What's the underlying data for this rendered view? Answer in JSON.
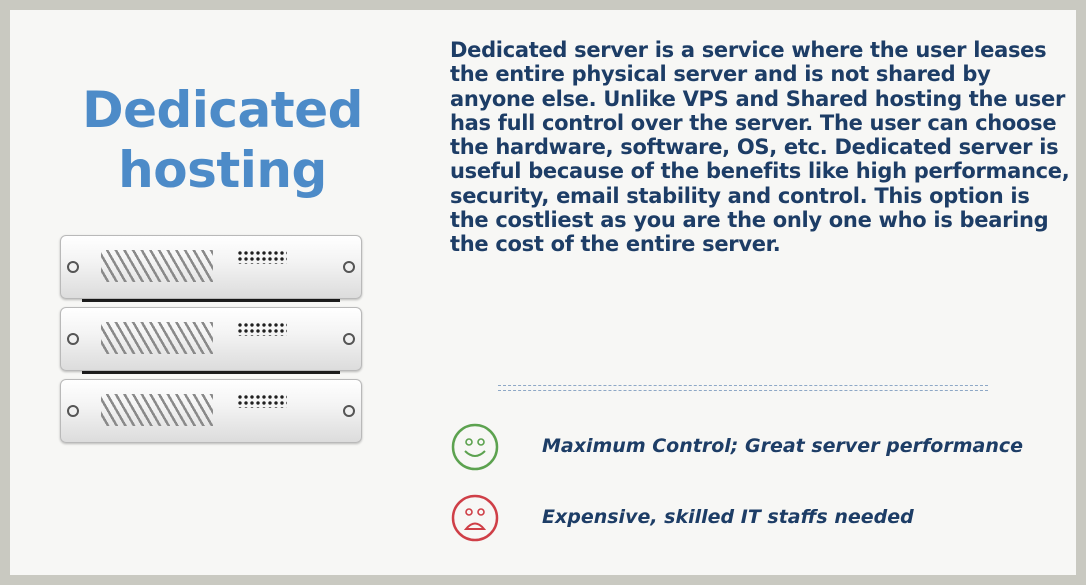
{
  "title_line1": "Dedicated",
  "title_line2": "hosting",
  "description": "Dedicated server is a service where the user leases the entire physical server and is not shared by anyone else. Unlike VPS and Shared hosting the user has full control over the server. The user can choose the hardware, software, OS, etc. Dedicated server is useful because of the benefits like high performance, security, email stability and control. This option is the costliest as you are the only one who is bearing the cost of the entire server.",
  "pros": {
    "icon": "smiley-face-icon",
    "text": "Maximum Control; Great server performance",
    "color": "#5ca24f"
  },
  "cons": {
    "icon": "sad-face-icon",
    "text": "Expensive, skilled IT staffs needed",
    "color": "#cf3f47"
  },
  "colors": {
    "title": "#4d8bc8",
    "body_text": "#1d3d66",
    "background": "#f7f7f5",
    "frame": "#c9c9c1"
  }
}
